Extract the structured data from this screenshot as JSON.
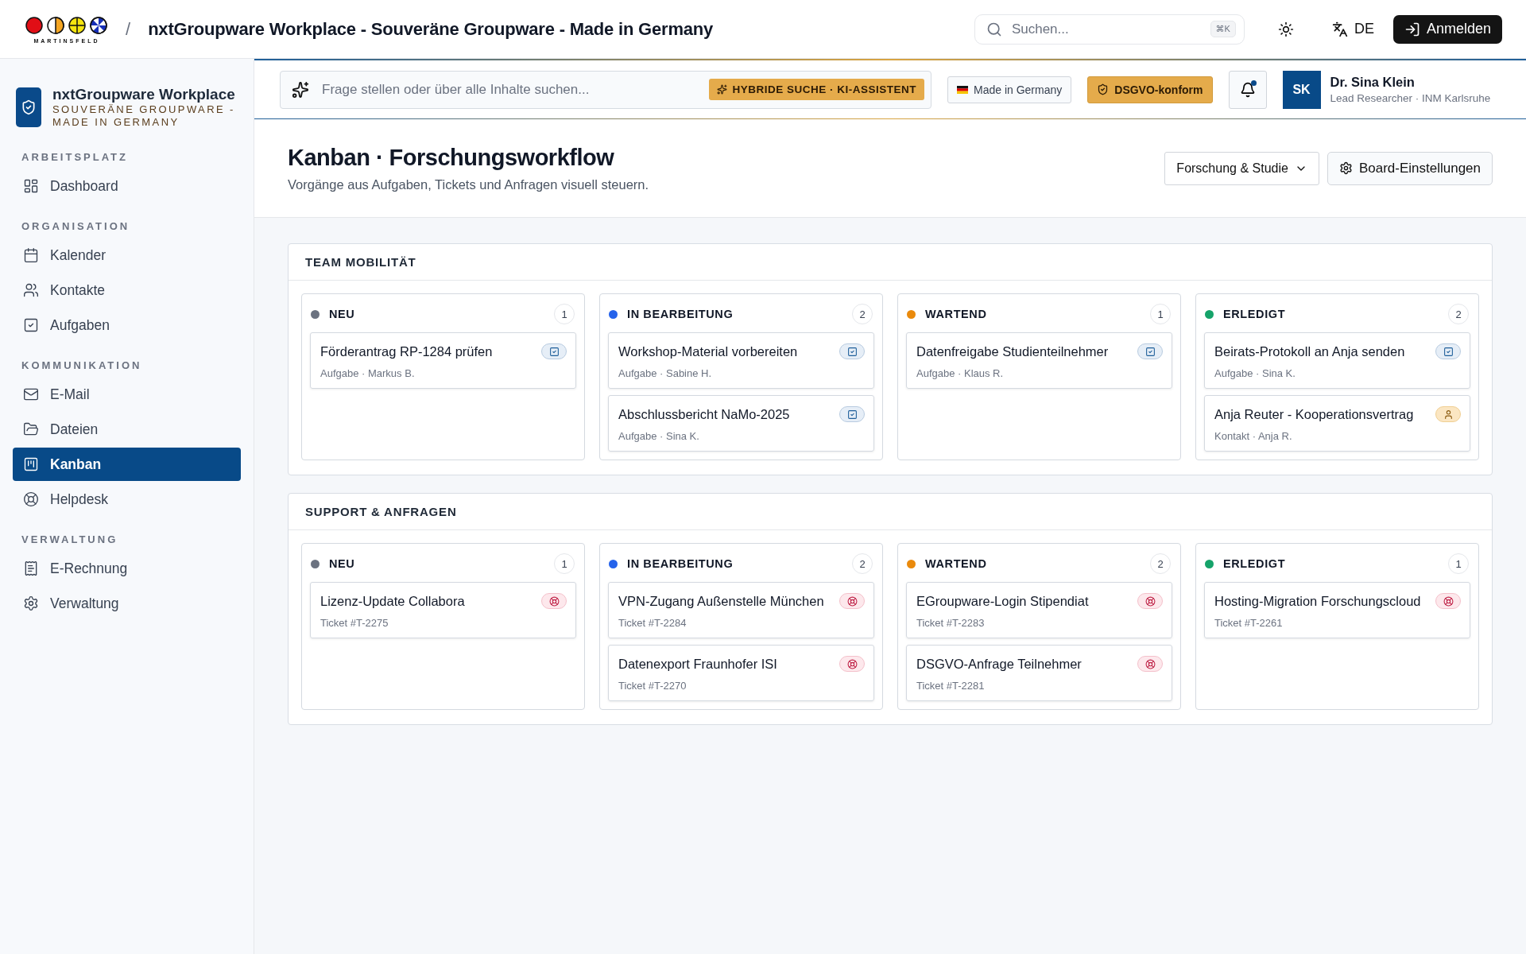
{
  "topbar": {
    "logo_text": "MARTINSFELD",
    "separator": "/",
    "title": "nxtGroupware Workplace - Souveräne Groupware - Made in Germany",
    "search": {
      "placeholder": "Suchen...",
      "shortcut": "⌘K"
    },
    "language": "DE",
    "login": "Anmelden"
  },
  "sidebar": {
    "brand": {
      "name": "nxtGroupware Workplace",
      "tagline": "SOUVERÄNE GROUPWARE - MADE IN GERMANY"
    },
    "sections": [
      {
        "title": "ARBEITSPLATZ",
        "items": [
          {
            "label": "Dashboard",
            "selected": false
          }
        ]
      },
      {
        "title": "ORGANISATION",
        "items": [
          {
            "label": "Kalender",
            "selected": false
          },
          {
            "label": "Kontakte",
            "selected": false
          },
          {
            "label": "Aufgaben",
            "selected": false
          }
        ]
      },
      {
        "title": "KOMMUNIKATION",
        "items": [
          {
            "label": "E-Mail",
            "selected": false
          },
          {
            "label": "Dateien",
            "selected": false
          },
          {
            "label": "Kanban",
            "selected": true
          },
          {
            "label": "Helpdesk",
            "selected": false
          }
        ]
      },
      {
        "title": "VERWALTUNG",
        "items": [
          {
            "label": "E-Rechnung",
            "selected": false
          },
          {
            "label": "Verwaltung",
            "selected": false
          }
        ]
      }
    ]
  },
  "subbar": {
    "ask": {
      "placeholder": "Frage stellen oder über alle Inhalte suchen...",
      "badge": "HYBRIDE SUCHE · KI-ASSISTENT"
    },
    "made_in": "Made in Germany",
    "gdpr": "DSGVO-konform",
    "notifications": {
      "unread": true
    },
    "user": {
      "initials": "SK",
      "name": "Dr. Sina Klein",
      "role": "Lead Researcher · INM Karlsruhe"
    }
  },
  "page": {
    "title": "Kanban · Forschungsworkflow",
    "subtitle": "Vorgänge aus Aufgaben, Tickets und Anfragen visuell steuern.",
    "filter": "Forschung & Studie",
    "settings": "Board-Einstellungen"
  },
  "boards": [
    {
      "title": "TEAM MOBILITÄT",
      "columns": [
        {
          "title": "NEU",
          "color": "#6b7280",
          "count": "1",
          "cards": [
            {
              "kind": "task",
              "title": "Förderantrag RP-1284 prüfen",
              "meta": "Aufgabe · Markus B."
            }
          ]
        },
        {
          "title": "IN BEARBEITUNG",
          "color": "#2563eb",
          "count": "2",
          "cards": [
            {
              "kind": "task",
              "title": "Workshop-Material vorbereiten",
              "meta": "Aufgabe · Sabine H."
            },
            {
              "kind": "task",
              "title": "Abschlussbericht NaMo-2025",
              "meta": "Aufgabe · Sina K."
            }
          ]
        },
        {
          "title": "WARTEND",
          "color": "#ea8a0c",
          "count": "1",
          "cards": [
            {
              "kind": "task",
              "title": "Datenfreigabe Studienteilnehmer",
              "meta": "Aufgabe · Klaus R."
            }
          ]
        },
        {
          "title": "ERLEDIGT",
          "color": "#16a36a",
          "count": "2",
          "cards": [
            {
              "kind": "task",
              "title": "Beirats-Protokoll an Anja senden",
              "meta": "Aufgabe · Sina K."
            },
            {
              "kind": "contact",
              "title": "Anja Reuter - Kooperationsvertrag",
              "meta": "Kontakt · Anja R."
            }
          ]
        }
      ]
    },
    {
      "title": "SUPPORT & ANFRAGEN",
      "columns": [
        {
          "title": "NEU",
          "color": "#6b7280",
          "count": "1",
          "cards": [
            {
              "kind": "ticket",
              "title": "Lizenz-Update Collabora",
              "meta": "Ticket #T-2275"
            }
          ]
        },
        {
          "title": "IN BEARBEITUNG",
          "color": "#2563eb",
          "count": "2",
          "cards": [
            {
              "kind": "ticket",
              "title": "VPN-Zugang Außenstelle München",
              "meta": "Ticket #T-2284"
            },
            {
              "kind": "ticket",
              "title": "Datenexport Fraunhofer ISI",
              "meta": "Ticket #T-2270"
            }
          ]
        },
        {
          "title": "WARTEND",
          "color": "#ea8a0c",
          "count": "2",
          "cards": [
            {
              "kind": "ticket",
              "title": "EGroupware-Login Stipendiat",
              "meta": "Ticket #T-2283"
            },
            {
              "kind": "ticket",
              "title": "DSGVO-Anfrage Teilnehmer",
              "meta": "Ticket #T-2281"
            }
          ]
        },
        {
          "title": "ERLEDIGT",
          "color": "#16a36a",
          "count": "1",
          "cards": [
            {
              "kind": "ticket",
              "title": "Hosting-Migration Forschungscloud",
              "meta": "Ticket #T-2261"
            }
          ]
        }
      ]
    }
  ]
}
